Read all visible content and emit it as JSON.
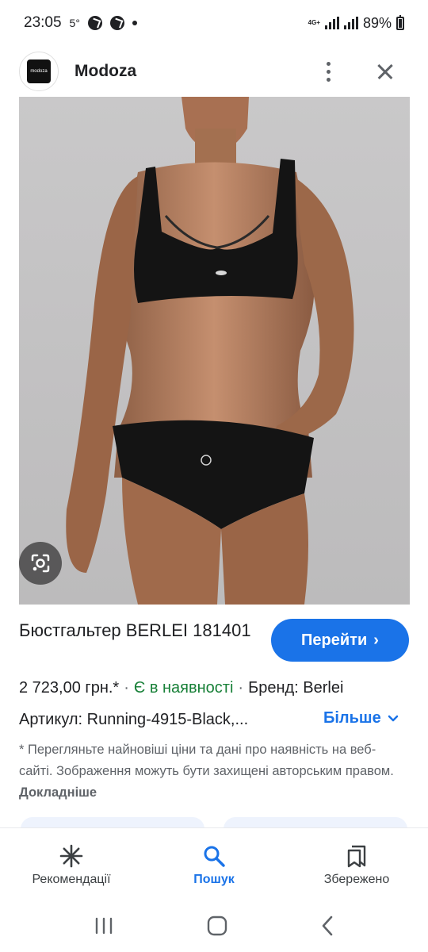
{
  "status_bar": {
    "time": "23:05",
    "temperature": "5°",
    "network": "4G+",
    "battery": "89%"
  },
  "header": {
    "site_name": "Modoza",
    "logo_text": "modoza"
  },
  "product": {
    "title": "Бюстгальтер BERLEI 181401",
    "visit_label": "Перейти",
    "price": "2 723,00 грн.*",
    "availability": "Є в наявності",
    "brand": "Бренд: Berlei",
    "sku": "Артикул: Running-4915-Black,...",
    "more_label": "Більше",
    "disclaimer": "* Перегляньте найновіші ціни та дані про наявність на веб-сайті. Зображення можуть бути захищені авторським правом.",
    "disclaimer_link": "Докладніше"
  },
  "bottom_nav": {
    "items": [
      {
        "label": "Рекомендації",
        "icon": "asterisk-icon"
      },
      {
        "label": "Пошук",
        "icon": "search-icon"
      },
      {
        "label": "Збережено",
        "icon": "bookmarks-icon"
      }
    ]
  },
  "colors": {
    "accent": "#1a73e8",
    "in_stock": "#188038",
    "text": "#202124",
    "muted": "#5f6368"
  }
}
